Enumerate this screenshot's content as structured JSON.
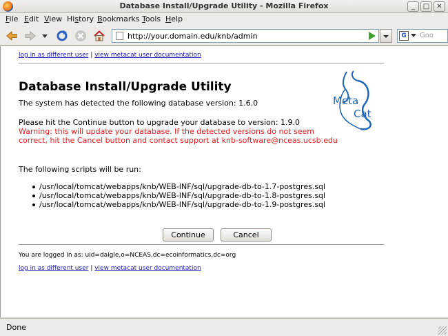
{
  "window": {
    "title": "Database Install/Upgrade Utility - Mozilla Firefox",
    "minimize": "_",
    "maximize": "□",
    "close": "✕"
  },
  "menu": [
    {
      "acc": "F",
      "rest": "ile"
    },
    {
      "acc": "E",
      "rest": "dit"
    },
    {
      "acc": "V",
      "rest": "iew"
    },
    {
      "acc": "",
      "pre": "Hi",
      "accMid": "s",
      "rest": "tory"
    },
    {
      "acc": "B",
      "rest": "ookmarks"
    },
    {
      "acc": "T",
      "rest": "ools"
    },
    {
      "acc": "H",
      "rest": "elp"
    }
  ],
  "toolbar": {
    "url": "http://your.domain.edu/knb/admin",
    "search_engine": "G",
    "search_placeholder": "Goo"
  },
  "page": {
    "links": {
      "relogin": "log in as different user",
      "separator": "|",
      "docs": "view metacat user documentation"
    },
    "heading": "Database Install/Upgrade Utility",
    "detected": "The system has detected the following database version: 1.6.0",
    "instruction": "Please hit the Continue button to upgrade your database to version: 1.9.0",
    "warning_line1": "Warning: this will update your database. If the detected versions do not seem",
    "warning_line2": "correct, hit the Cancel button and contact support at knb-software@nceas.ucsb.edu",
    "scripts_intro": "The following scripts will be run:",
    "scripts": [
      "/usr/local/tomcat/webapps/knb/WEB-INF/sql/upgrade-db-to-1.7-postgres.sql",
      "/usr/local/tomcat/webapps/knb/WEB-INF/sql/upgrade-db-to-1.8-postgres.sql",
      "/usr/local/tomcat/webapps/knb/WEB-INF/sql/upgrade-db-to-1.9-postgres.sql"
    ],
    "continue_label": "Continue",
    "cancel_label": "Cancel",
    "logged_in": "You are logged in as: uid=daigle,o=NCEAS,dc=ecoinformatics,dc=org",
    "logo_text1": "Meta",
    "logo_text2": "Cat"
  },
  "status": {
    "text": "Done"
  },
  "colors": {
    "link": "#1a1ab4",
    "warning": "#e01c1c",
    "logo": "#1e64b4"
  }
}
